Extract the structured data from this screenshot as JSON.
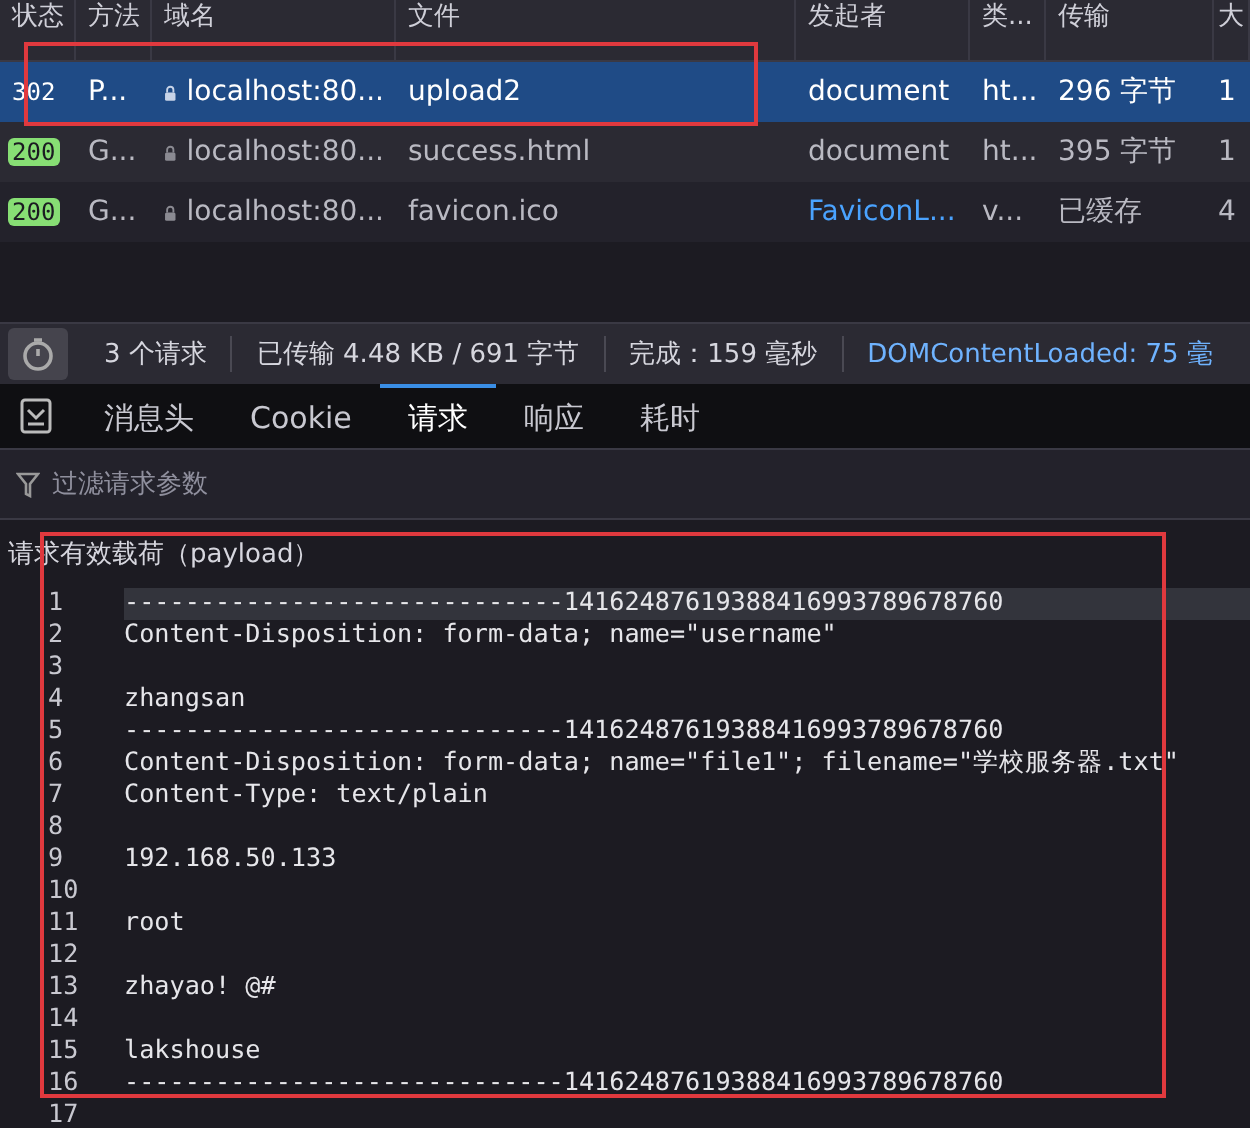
{
  "columns": [
    "状态",
    "方法",
    "域名",
    "文件",
    "发起者",
    "类...",
    "传输",
    "大"
  ],
  "requests": [
    {
      "status": "302",
      "method": "P...",
      "domain": "localhost:80...",
      "file": "upload2",
      "initiator": "document",
      "initiator_link": false,
      "type": "ht...",
      "transfer": "296 字节",
      "size": "1",
      "selected": true
    },
    {
      "status": "200",
      "method": "G...",
      "domain": "localhost:80...",
      "file": "success.html",
      "initiator": "document",
      "initiator_link": false,
      "type": "ht...",
      "transfer": "395 字节",
      "size": "1",
      "selected": false
    },
    {
      "status": "200",
      "method": "G...",
      "domain": "localhost:80...",
      "file": "favicon.ico",
      "initiator": "FaviconL...",
      "initiator_link": true,
      "type": "v...",
      "transfer": "已缓存",
      "size": "4",
      "selected": false
    }
  ],
  "summary": [
    {
      "text": "3 个请求",
      "link": false
    },
    {
      "text": "已传输 4.48 KB / 691 字节",
      "link": false
    },
    {
      "text": "完成：159 毫秒",
      "link": false
    },
    {
      "text": "DOMContentLoaded: 75 毫",
      "link": true
    }
  ],
  "tabs": [
    {
      "label": "消息头",
      "selected": false
    },
    {
      "label": "Cookie",
      "selected": false
    },
    {
      "label": "请求",
      "selected": true
    },
    {
      "label": "响应",
      "selected": false
    },
    {
      "label": "耗时",
      "selected": false
    }
  ],
  "filter": {
    "placeholder": "过滤请求参数"
  },
  "payload_title": "请求有效载荷（payload）",
  "code_lines": [
    {
      "number": "1",
      "text": "-----------------------------14162487619388416993789678760",
      "current": true
    },
    {
      "number": "2",
      "text": "Content-Disposition: form-data; name=\"username\"",
      "current": false
    },
    {
      "number": "3",
      "current": false
    },
    {
      "number": "4",
      "text": "zhangsan",
      "current": false
    },
    {
      "number": "5",
      "text": "-----------------------------14162487619388416993789678760",
      "current": false
    },
    {
      "number": "6",
      "text": "Content-Disposition: form-data; name=\"file1\"; filename=\"学校服务器.txt\"",
      "current": false
    },
    {
      "number": "7",
      "text": "Content-Type: text/plain",
      "current": false
    },
    {
      "number": "8",
      "current": false
    },
    {
      "number": "9",
      "text": "192.168.50.133",
      "current": false
    },
    {
      "number": "10",
      "current": false
    },
    {
      "number": "11",
      "text": "root",
      "current": false
    },
    {
      "number": "12",
      "current": false
    },
    {
      "number": "13",
      "text": "zhayao! @#",
      "current": false
    },
    {
      "number": "14",
      "current": false
    },
    {
      "number": "15",
      "text": "lakshouse",
      "current": false
    },
    {
      "number": "16",
      "text": "-----------------------------14162487619388416993789678760",
      "current": false
    },
    {
      "number": "17",
      "current": false
    }
  ]
}
